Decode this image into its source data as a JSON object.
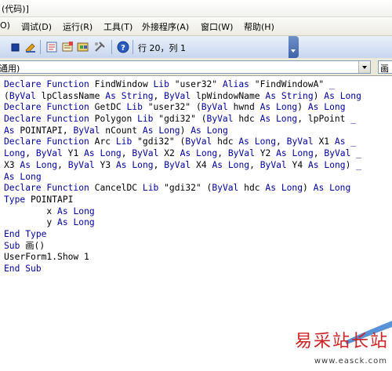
{
  "window": {
    "title": "(代码)]"
  },
  "menubar": {
    "items": [
      {
        "label": "O)"
      },
      {
        "label": "调试(D)"
      },
      {
        "label": "运行(R)"
      },
      {
        "label": "工具(T)"
      },
      {
        "label": "外接程序(A)"
      },
      {
        "label": "窗口(W)"
      },
      {
        "label": "帮助(H)"
      }
    ]
  },
  "toolbar": {
    "position_text": "行 20，列 1"
  },
  "selectors": {
    "object_value": "通用)",
    "procedure_value": "画"
  },
  "code_lines": [
    "Declare Function FindWindow Lib \"user32\" Alias \"FindWindowA\" _",
    "(ByVal lpClassName As String, ByVal lpWindowName As String) As Long",
    "Declare Function GetDC Lib \"user32\" (ByVal hwnd As Long) As Long",
    "Declare Function Polygon Lib \"gdi32\" (ByVal hdc As Long, lpPoint _",
    "As POINTAPI, ByVal nCount As Long) As Long",
    "Declare Function Arc Lib \"gdi32\" (ByVal hdc As Long, ByVal X1 As _",
    "Long, ByVal Y1 As Long, ByVal X2 As Long, ByVal Y2 As Long, ByVal _",
    "X3 As Long, ByVal Y3 As Long, ByVal X4 As Long, ByVal Y4 As Long) _",
    "As Long",
    "Declare Function CancelDC Lib \"gdi32\" (ByVal hdc As Long) As Long",
    "Type POINTAPI",
    "        x As Long",
    "        y As Long",
    "End Type",
    "Sub 画()",
    "UserForm1.Show 1",
    "End Sub"
  ],
  "watermark": {
    "title": "易采站长站",
    "url": "www.easck.com"
  },
  "colors": {
    "keyword": "#0000a0",
    "identifier": "#000000",
    "toolbar": "#c7d6ee",
    "watermark": "#cc2222"
  },
  "icons": [
    "stop-icon",
    "design-mode-icon",
    "project-explorer-icon",
    "properties-icon",
    "object-browser-icon",
    "toolbox-icon",
    "help-icon"
  ]
}
